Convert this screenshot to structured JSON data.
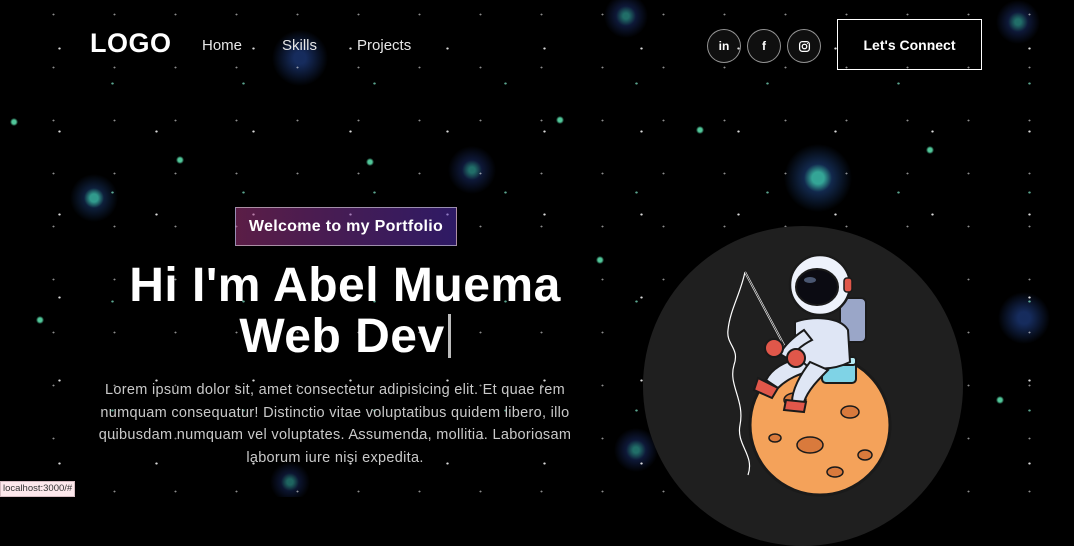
{
  "nav": {
    "logo": "LOGO",
    "links": [
      "Home",
      "Skills",
      "Projects"
    ],
    "socials": [
      {
        "icon": "linkedin-icon",
        "glyph": "in"
      },
      {
        "icon": "facebook-icon",
        "glyph": "f"
      },
      {
        "icon": "instagram-icon",
        "glyph": ""
      }
    ],
    "connect_label": "Let's Connect"
  },
  "hero": {
    "tagline": "Welcome to my Portfolio",
    "headline_line1": "Hi I'm Abel Muema",
    "headline_line2": "Web Dev",
    "intro": "Lorem ipsum dolor sit, amet consectetur adipisicing elit. Et quae rem numquam consequatur! Distinctio vitae voluptatibus quidem libero, illo quibusdam numquam vel voluptates. Assumenda, mollitia. Laboriosam laborum iure nisi expedita."
  },
  "illustration": {
    "icon": "astronaut-on-moon-illustration"
  },
  "status": {
    "url": "localhost:3000/#"
  }
}
